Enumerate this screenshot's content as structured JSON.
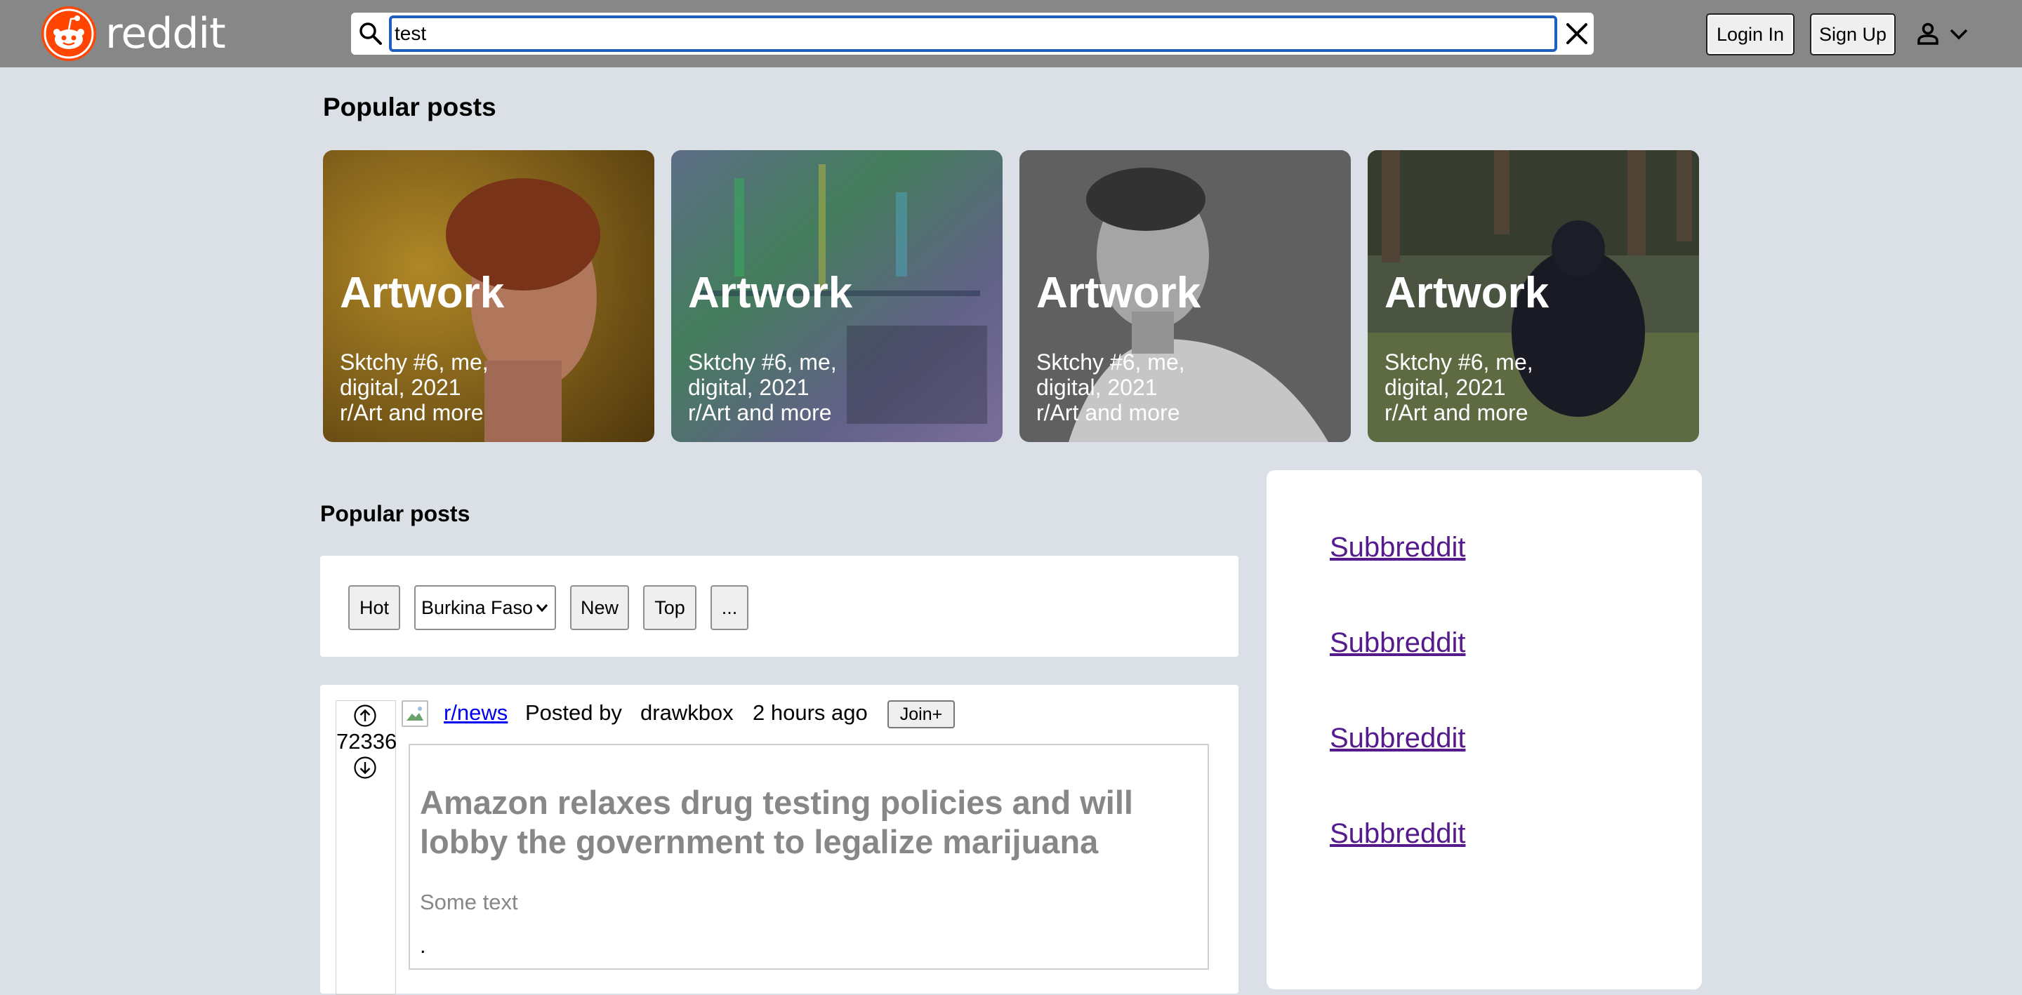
{
  "header": {
    "logo_text": "reddit",
    "search_value": "test",
    "login_label": "Login In",
    "signup_label": "Sign Up"
  },
  "popular": {
    "heading": "Popular posts",
    "cards": [
      {
        "title": "Artwork",
        "desc": "Sktchy #6, me, digital, 2021",
        "sub": "r/Art and more",
        "image": "woman-portrait"
      },
      {
        "title": "Artwork",
        "desc": "Sktchy #6, me, digital, 2021",
        "sub": "r/Art and more",
        "image": "abstract-city-lights"
      },
      {
        "title": "Artwork",
        "desc": "Sktchy #6, me, digital, 2021",
        "sub": "r/Art and more",
        "image": "man-black-white"
      },
      {
        "title": "Artwork",
        "desc": "Sktchy #6, me, digital, 2021",
        "sub": "r/Art and more",
        "image": "gorilla"
      }
    ]
  },
  "feed": {
    "heading": "Popular posts",
    "filters": {
      "hot": "Hot",
      "location_selected": "Burkina Faso",
      "new": "New",
      "top": "Top",
      "more": "..."
    }
  },
  "post": {
    "votes": "72336",
    "subreddit": "r/news",
    "posted_by": "Posted by",
    "author": "drawkbox",
    "time": "2 hours ago",
    "join_label": "Join+",
    "title": "Amazon relaxes drug testing policies and will lobby the government to legalize marijuana",
    "text": "Some text",
    "trailing": "."
  },
  "sidebar": {
    "links": [
      "Subbreddit",
      "Subbreddit",
      "Subbreddit",
      "Subbreddit"
    ]
  },
  "colors": {
    "header_bg": "#878787",
    "page_bg": "#dae0e6",
    "brand": "#ff4500",
    "link": "#0000ee",
    "visited_link": "#551a8b",
    "focus_ring": "#1f5fbf"
  }
}
